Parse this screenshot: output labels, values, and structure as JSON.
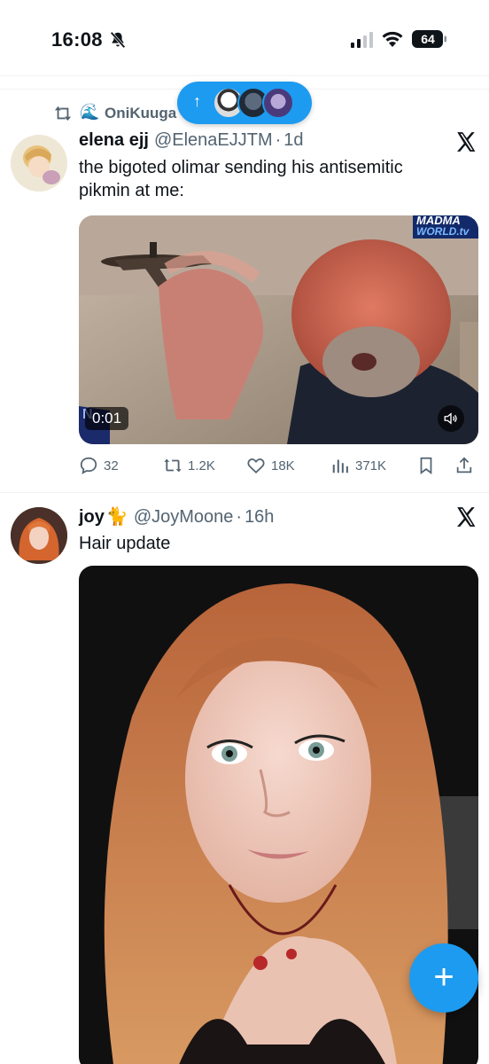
{
  "status_bar": {
    "time": "16:08",
    "battery": "64"
  },
  "retweet": {
    "label": "OniKuuga"
  },
  "tweets": [
    {
      "name": "elena ejj",
      "handle": "@ElenaEJJTM",
      "age": "1d",
      "text_lines": [
        "the bigoted olimar sending his antisemitic",
        "pikmin at me:"
      ],
      "video": {
        "duration": "0:01",
        "watermark_line1": "MADMA",
        "watermark_line2": "WORLD.tv",
        "corner_text": "N"
      },
      "actions": {
        "replies": "32",
        "reposts": "1.2K",
        "likes": "18K",
        "views": "371K"
      }
    },
    {
      "name": "joy",
      "name_emoji": "🐈",
      "handle": "@JoyMoone",
      "age": "16h",
      "text": "Hair update"
    }
  ],
  "fab": {
    "label": "+"
  },
  "colors": {
    "accent": "#1d9bf0",
    "muted": "#536471",
    "text": "#0f1419"
  },
  "icons": [
    "bell-slash-icon",
    "signal-icon",
    "wifi-icon",
    "battery-icon",
    "up-arrow-icon",
    "retweet-icon",
    "x-logo-icon",
    "reply-icon",
    "like-icon",
    "views-icon",
    "bookmark-icon",
    "share-icon",
    "speaker-icon",
    "plus-icon"
  ]
}
